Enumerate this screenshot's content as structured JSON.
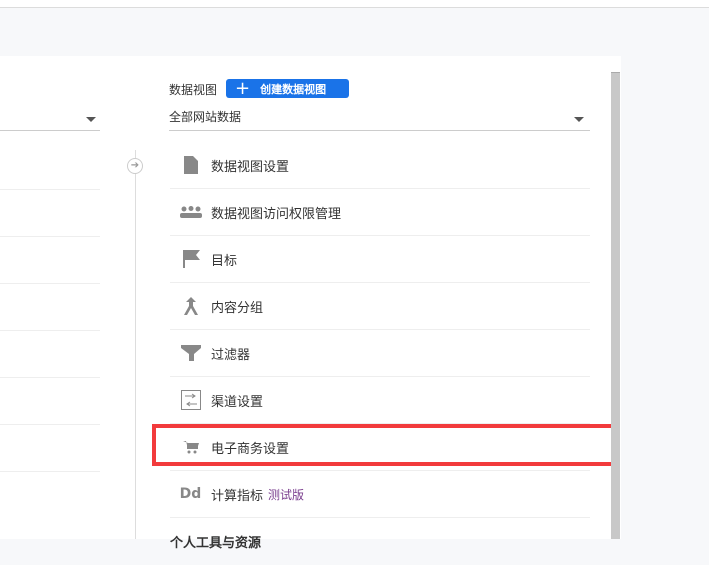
{
  "view": {
    "label": "数据视图",
    "create_button": "创建数据视图",
    "selected_view": "全部网站数据"
  },
  "items": [
    {
      "label": "数据视图设置",
      "icon": "document-icon"
    },
    {
      "label": "数据视图访问权限管理",
      "icon": "people-icon"
    },
    {
      "label": "目标",
      "icon": "flag-icon"
    },
    {
      "label": "内容分组",
      "icon": "merge-icon"
    },
    {
      "label": "过滤器",
      "icon": "filter-icon"
    },
    {
      "label": "渠道设置",
      "icon": "channel-icon"
    },
    {
      "label": "电子商务设置",
      "icon": "cart-icon"
    },
    {
      "label": "计算指标",
      "icon": "dd-icon",
      "badge": "测试版",
      "glyph": "Dd"
    },
    {
      "label": "个人工具与资源"
    }
  ],
  "colors": {
    "accent": "#1a73e8",
    "highlight": "#f23a3c"
  }
}
